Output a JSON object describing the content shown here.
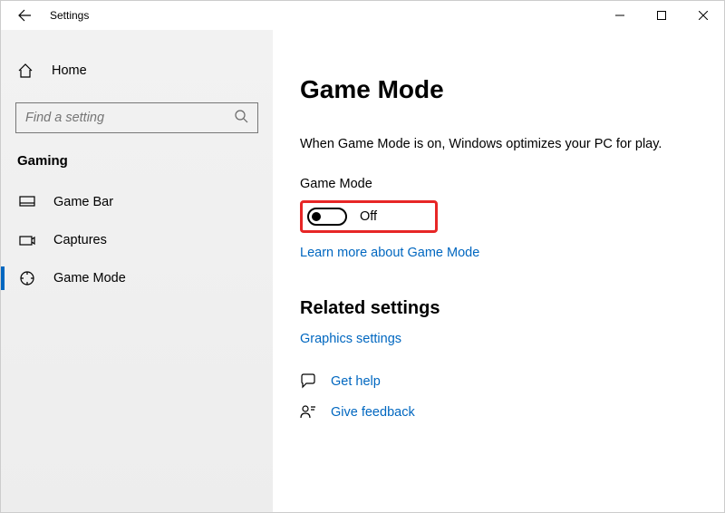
{
  "titlebar": {
    "title": "Settings"
  },
  "sidebar": {
    "home_label": "Home",
    "search_placeholder": "Find a setting",
    "category": "Gaming",
    "items": [
      {
        "label": "Game Bar"
      },
      {
        "label": "Captures"
      },
      {
        "label": "Game Mode"
      }
    ],
    "active_index": 2
  },
  "content": {
    "title": "Game Mode",
    "description": "When Game Mode is on, Windows optimizes your PC for play.",
    "toggle_label": "Game Mode",
    "toggle_state": "Off",
    "learn_more": "Learn more about Game Mode",
    "related_heading": "Related settings",
    "graphics_link": "Graphics settings",
    "get_help": "Get help",
    "give_feedback": "Give feedback"
  }
}
